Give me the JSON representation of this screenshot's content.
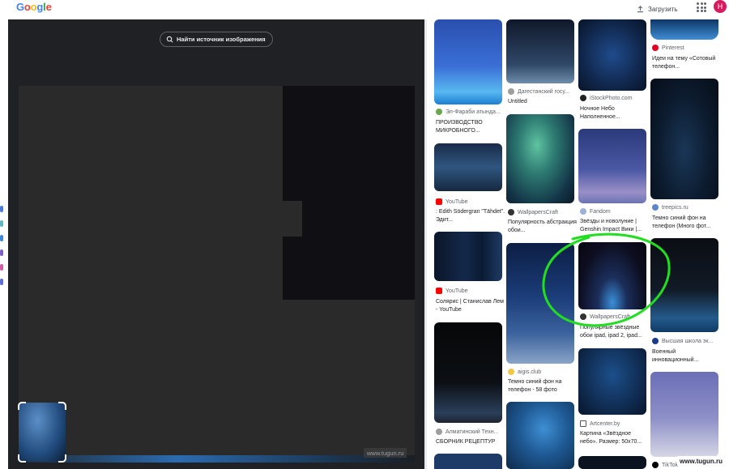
{
  "header": {
    "logo_letters": [
      "G",
      "o",
      "o",
      "g",
      "l",
      "e"
    ],
    "logo_colors": [
      "#4285f4",
      "#ea4335",
      "#fbbc05",
      "#4285f4",
      "#34a853",
      "#ea4335"
    ],
    "upload_label": "Загрузить",
    "avatar_letter": "Н",
    "avatar_color": "#d81b60"
  },
  "viewer": {
    "find_source_label": "Найти источник изображения",
    "watermark": "www.tugun.ru"
  },
  "results": [
    {
      "source": "Эл-Фараби атында...",
      "caption": "ПРОИЗВОДСТВО МИКРОБНОГО..."
    },
    {
      "source": "YouTube",
      "caption": ": Edith Södergran \"Tähdet\". Эдит..."
    },
    {
      "source": "YouTube",
      "caption": "Солярис | Станислав Лем - YouTube"
    },
    {
      "source": "Алматинский Техн...",
      "caption": "СБОРНИК РЕЦЕПТУР"
    },
    {
      "source": "Дагестанский госу...",
      "caption": "Untitled"
    },
    {
      "source": "WallpapersCraft",
      "caption": "Популярность абстракция обои..."
    },
    {
      "source": "aigis.club",
      "caption": "Темно синий фон на телефон - 58 фото"
    },
    {
      "source": "iStockPhoto.com",
      "caption": "Ночное Небо Наполненное..."
    },
    {
      "source": "Fandom",
      "caption": "Звёзды и новолуние | Genshin Impact Вики |..."
    },
    {
      "source": "WallpapersCraft",
      "caption": "Популярные звёздные обои ipad, ipad 2, ipad..."
    },
    {
      "source": "Artcenter.by",
      "caption": "Картина «Звёздное небо». Размер: 50x70..."
    },
    {
      "source": "Pinterest",
      "caption": "Идеи на тему «Сотовый телефон..."
    },
    {
      "source": "treepics.ru",
      "caption": "Темно синий фон на телефон (Много фот..."
    },
    {
      "source": "Высшая школа эк...",
      "caption": "Военный инновационный..."
    },
    {
      "source": "TikTok",
      "caption": ""
    }
  ],
  "watermark_right": "www.tugun.ru",
  "annotation_color": "#22dd22"
}
